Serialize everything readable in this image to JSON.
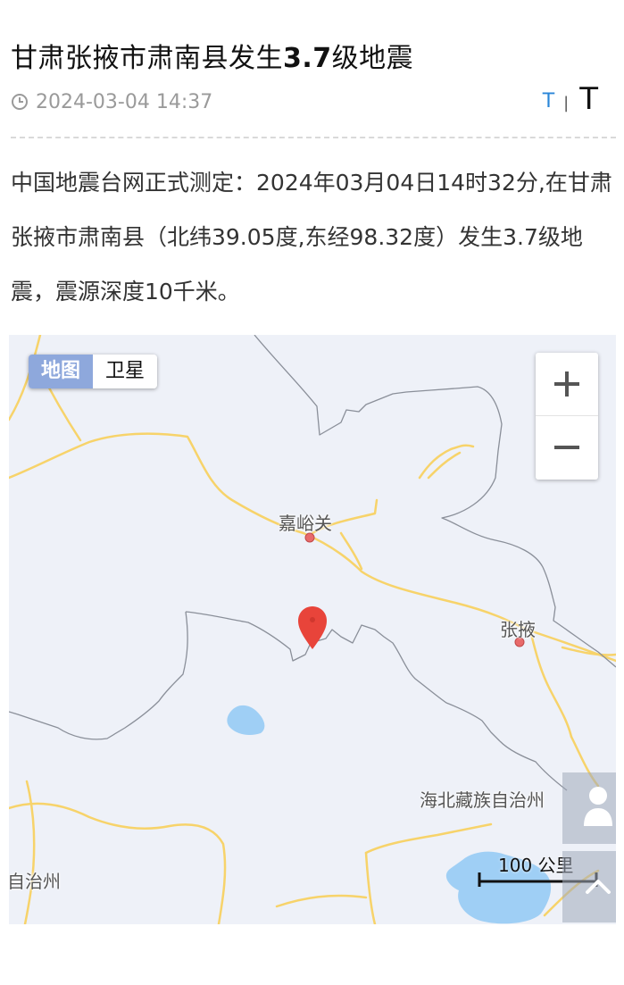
{
  "article": {
    "title_prefix": "甘肃张掖市肃南县发生",
    "title_magnitude": "3.7",
    "title_suffix": "级地震",
    "datetime": "2024-03-04 14:37",
    "font_small_label": "T",
    "font_separator": "|",
    "font_large_label": "T",
    "body": "中国地震台网正式测定：2024年03月04日14时32分,在甘肃张掖市肃南县（北纬39.05度,东经98.32度）发生3.7级地震，震源深度10千米。"
  },
  "map": {
    "toggle_map": "地图",
    "toggle_satellite": "卫星",
    "zoom_in_label": "zoom-in",
    "zoom_out_label": "zoom-out",
    "labels": {
      "jiayuguan": "嘉峪关",
      "zhangye": "张掖",
      "haibei": "海北藏族自治州",
      "left_region": "自治州"
    },
    "scale": "100 公里",
    "colors": {
      "land": "#eef1f8",
      "road": "#f7d36a",
      "border": "#8a8f99",
      "water": "#9fcff5",
      "marker": "#e8443a",
      "city_dot": "#e86a6a",
      "toggle_active": "#8ea8dc"
    },
    "icons": [
      "clock-icon",
      "location-pin-icon",
      "user-icon",
      "chevron-up-icon",
      "plus-icon",
      "minus-icon"
    ]
  }
}
